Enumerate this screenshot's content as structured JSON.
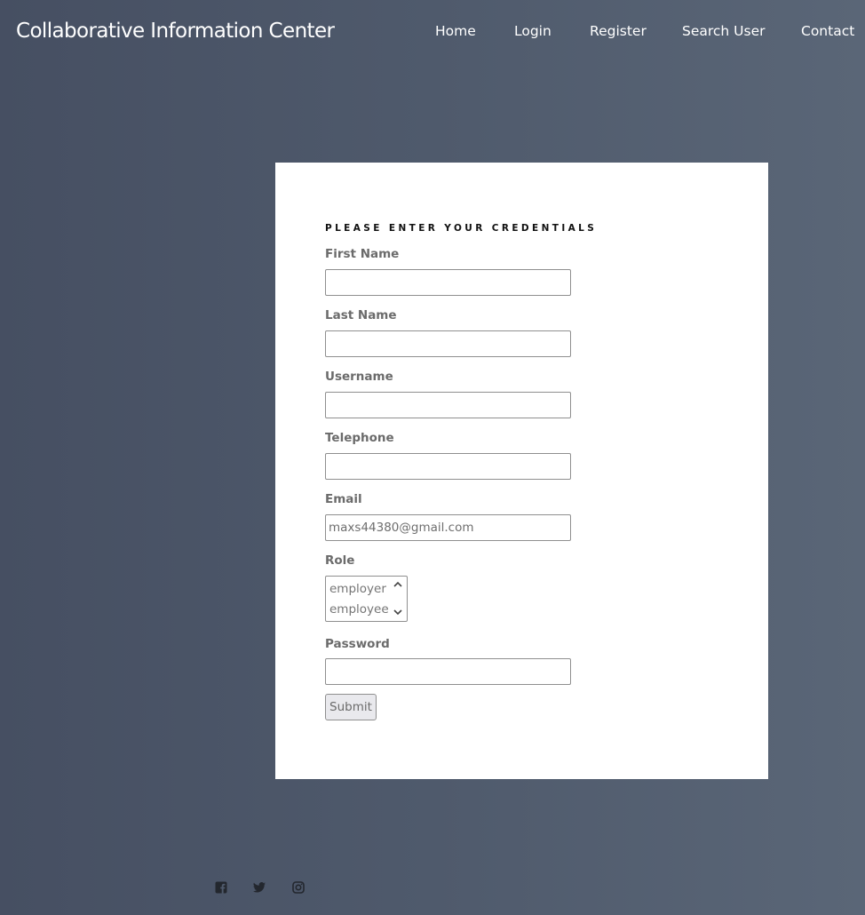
{
  "header": {
    "title": "Collaborative Information Center",
    "nav": [
      {
        "label": "Home"
      },
      {
        "label": "Login"
      },
      {
        "label": "Register"
      },
      {
        "label": "Search User"
      },
      {
        "label": "Contact"
      }
    ]
  },
  "form": {
    "heading": "PLEASE ENTER YOUR CREDENTIALS",
    "fields": {
      "first_name": {
        "label": "First Name",
        "value": ""
      },
      "last_name": {
        "label": "Last Name",
        "value": ""
      },
      "username": {
        "label": "Username",
        "value": ""
      },
      "telephone": {
        "label": "Telephone",
        "value": ""
      },
      "email": {
        "label": "Email",
        "value": "maxs44380@gmail.com"
      },
      "password": {
        "label": "Password",
        "value": ""
      }
    },
    "role": {
      "label": "Role",
      "options": [
        "employer",
        "employee"
      ]
    },
    "submit_label": "Submit"
  },
  "footer": {
    "social_icons": [
      "facebook-icon",
      "twitter-icon",
      "instagram-icon"
    ]
  }
}
